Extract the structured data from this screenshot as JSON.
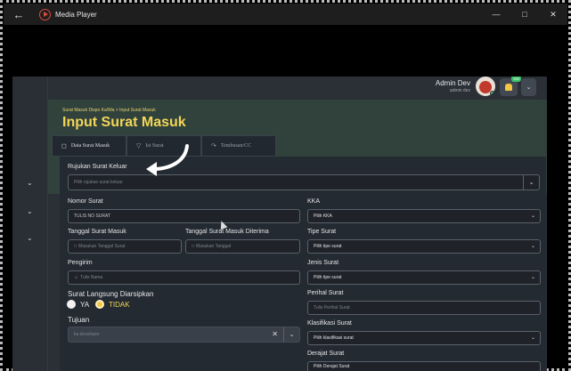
{
  "window": {
    "back_icon": "arrow-left-icon",
    "app_icon": "play-circle-icon",
    "title": "Media Player",
    "controls": [
      "—",
      "□",
      "✕"
    ]
  },
  "topbar": {
    "user_name": "Admin Dev",
    "user_role": "admin dev",
    "notif_count": "999"
  },
  "header": {
    "breadcrumb": "Surat Masuk Dispo Ka/Wa  >  Input Surat Masuk",
    "title": "Input Surat Masuk"
  },
  "tabs": [
    {
      "label": "Data Surat Masuk",
      "icon": "document-icon"
    },
    {
      "label": "Isi Surat",
      "icon": "gear-icon"
    },
    {
      "label": "Tembusan/CC",
      "icon": "share-icon"
    }
  ],
  "form": {
    "rujukan_label": "Rujukan Surat Keluar",
    "rujukan_placeholder": "Pilih rujukan surat keluar",
    "nomor_label": "Nomor Surat",
    "nomor_value": "TULIS NO SURAT",
    "tanggal_label": "Tanggal Surat Masuk",
    "tanggal_placeholder": "Masukan Tanggal Surat",
    "diterima_label": "Tanggal Surat Masuk Diterima",
    "diterima_placeholder": "Masukan Tanggal",
    "pengirim_label": "Pengirim",
    "pengirim_placeholder": "Tulis Nama",
    "arsip_label": "Surat Langsung Diarsipkan",
    "arsip_yes": "YA",
    "arsip_no": "TIDAK",
    "arsip_selected": "TIDAK",
    "tujuan_label": "Tujuan",
    "tujuan_value": "ka developer",
    "kka_label": "KKA",
    "kka_value": "Pilih KKA",
    "tipe_label": "Tipe Surat",
    "tipe_value": "Pilih tipe surat",
    "jenis_label": "Jenis Surat",
    "jenis_value": "Pilih tipe surat",
    "perihal_label": "Perihal Surat",
    "perihal_placeholder": "Tulis Perihal Surat",
    "klasifikasi_label": "Klasifikasi Surat",
    "klasifikasi_value": "Pilih klasifikasi surat",
    "derajat_label": "Derajat Surat",
    "derajat_value": "Pilih Derajat Surat"
  }
}
